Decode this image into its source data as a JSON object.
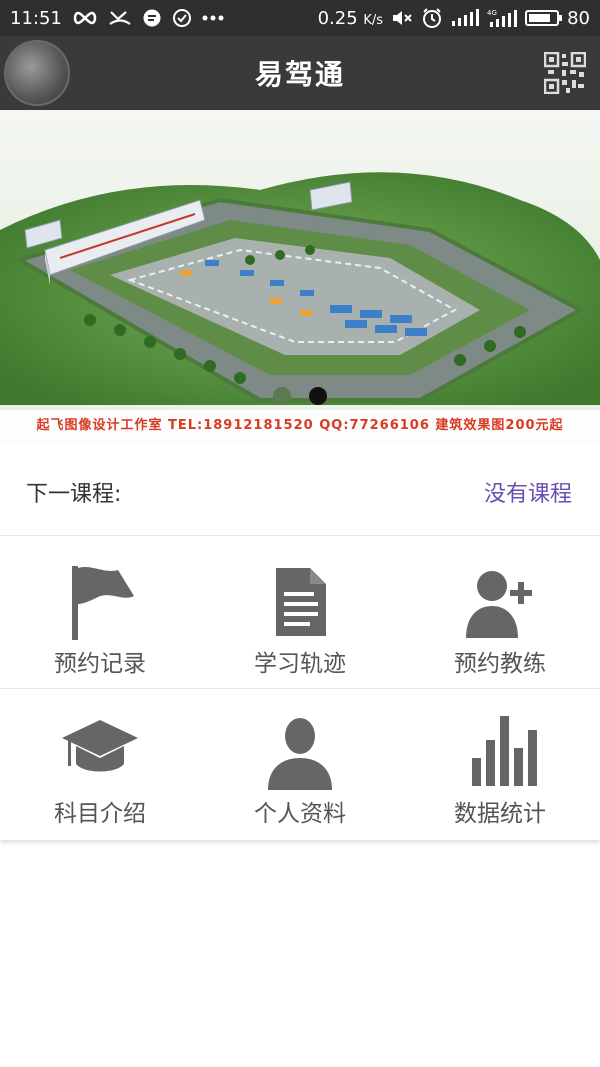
{
  "status_bar": {
    "time": "11:51",
    "speed": "0.25",
    "speed_unit": "K/s",
    "battery": "80",
    "battery_level": 0.8
  },
  "app_bar": {
    "title": "易驾通",
    "avatar_icon": "avatar-image",
    "right_icon": "qr-code-icon"
  },
  "banner": {
    "caption": "起飞图像设计工作室  TEL:18912181520 QQ:77266106  建筑效果图200元起",
    "active_dot": 1,
    "dot_count": 2
  },
  "next_course": {
    "label": "下一课程:",
    "value": "没有课程",
    "value_color": "#6a4fb3"
  },
  "grid": {
    "items": [
      {
        "label": "预约记录",
        "icon": "flag-icon"
      },
      {
        "label": "学习轨迹",
        "icon": "document-icon"
      },
      {
        "label": "预约教练",
        "icon": "add-user-icon"
      },
      {
        "label": "科目介绍",
        "icon": "graduation-cap-icon"
      },
      {
        "label": "个人资料",
        "icon": "person-icon"
      },
      {
        "label": "数据统计",
        "icon": "bar-chart-icon"
      }
    ],
    "icon_color": "#666666"
  }
}
